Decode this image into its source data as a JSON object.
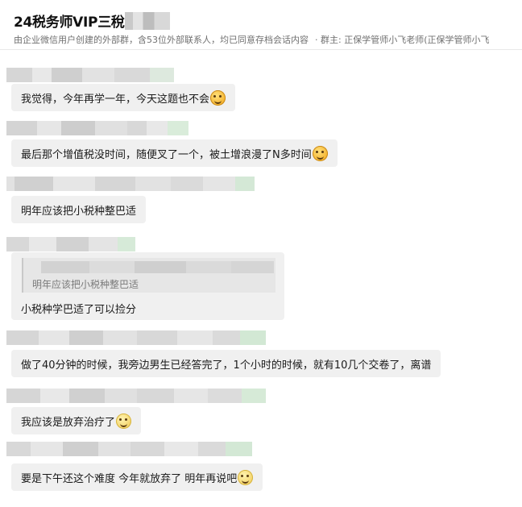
{
  "header": {
    "title": "24税务师VIP三稅",
    "subtitle": "由企业微信用户创建的外部群，含53位外部联系人，均已同意存档会话内容",
    "owner": "· 群主: 正保学管师小飞老师(正保学管师小飞"
  },
  "messages": [
    {
      "text": "我觉得，今年再学一年，今天这题也不会",
      "emoji": "facepalm-emoji"
    },
    {
      "text": "最后那个增值税没时间，随便叉了一个，被土增浪漫了N多时间",
      "emoji": "facepalm-emoji"
    },
    {
      "text": "明年应该把小税种整巴适"
    },
    {
      "quoted_text": "明年应该把小税种整巴适",
      "reply": "小税种学巴适了可以捡分"
    },
    {
      "text": "做了40分钟的时候，我旁边男生已经答完了，1个小时的时候，就有10几个交卷了，离谱"
    },
    {
      "text": "我应该是放弃治疗了",
      "emoji": "shushing-emoji"
    },
    {
      "text": "要是下午还这个难度  今年就放弃了  明年再说吧",
      "emoji": "worried-emoji"
    }
  ]
}
